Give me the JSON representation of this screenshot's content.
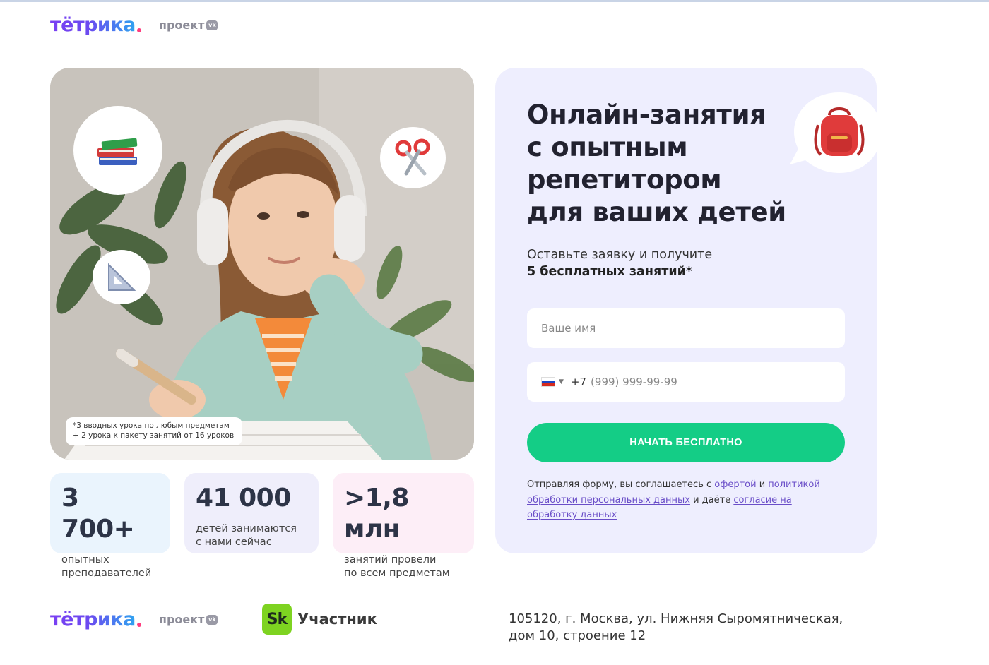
{
  "header": {
    "logo_word": "тётрика",
    "logo_project": "проект",
    "vk": "vk"
  },
  "photo": {
    "bubbles": [
      "books-icon",
      "scissors-icon",
      "triangle-ruler-icon"
    ],
    "footnote_line1": "*3 вводных урока по любым предметам",
    "footnote_line2": "+ 2 урока к пакету занятий от 16 уроков"
  },
  "stats": [
    {
      "number": "3 700+",
      "label_line1": "опытных",
      "label_line2": "преподавателей",
      "bg": "#eaf4fd"
    },
    {
      "number": "41 000",
      "label_line1": "детей занимаются",
      "label_line2": "с нами сейчас",
      "bg": "#efeefb"
    },
    {
      "number": ">1,8 млн",
      "label_line1": "занятий провели",
      "label_line2": "по всем предметам",
      "bg": "#fdeef7"
    }
  ],
  "form": {
    "title_line1": "Онлайн-занятия",
    "title_line2": "с опытным",
    "title_line3": "репетитором",
    "title_line4": "для ваших детей",
    "subtitle_line1": "Оставьте заявку и получите",
    "subtitle_line2": "5 бесплатных занятий*",
    "name_placeholder": "Ваше имя",
    "phone_code": "+7",
    "phone_placeholder": "(999) 999-99-99",
    "submit_label": "НАЧАТЬ БЕСПЛАТНО",
    "legal_1": "Отправляя форму, вы соглашаетесь с ",
    "legal_link_offer": "офертой",
    "legal_2": " и ",
    "legal_link_policy": "политикой обработки персональных данных",
    "legal_3": " и даёте ",
    "legal_link_consent": "согласие на обработку данных",
    "accent": "#14cd86"
  },
  "footer": {
    "logo_word": "тётрика",
    "logo_project": "проект",
    "vk": "vk",
    "sk_badge": "Sk",
    "sk_label": "Участник",
    "address_line1": "105120, г. Москва, ул. Нижняя Сыромятническая,",
    "address_line2": "дом 10, строение 12"
  }
}
